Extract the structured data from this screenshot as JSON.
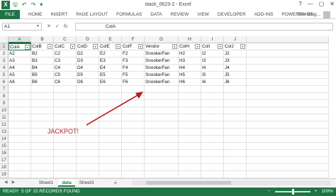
{
  "app": {
    "logo_letter": "X",
    "window_title": "stack_0623-2 - Excel",
    "help": "?",
    "minimize": "—",
    "restore": "▢",
    "close": "✕"
  },
  "qat": {
    "save": "🖫",
    "undo": "↶",
    "redo": "↷",
    "customize": "▾"
  },
  "ribbon": {
    "file": "FILE",
    "tabs": [
      "HOME",
      "INSERT",
      "PAGE LAYOUT",
      "FORMULAS",
      "DATA",
      "REVIEW",
      "VIEW",
      "DEVELOPER",
      "ADD-INS",
      "POWERPIVOT"
    ],
    "user": "Dan Wag..."
  },
  "formula_bar": {
    "name_box": "A1",
    "cancel": "✕",
    "enter": "✓",
    "fx": "fx",
    "content": "ColA"
  },
  "grid": {
    "columns": [
      "A",
      "B",
      "C",
      "D",
      "E",
      "F",
      "G",
      "H",
      "I",
      "J"
    ],
    "rows": [
      "1",
      "2",
      "3",
      "4",
      "5",
      "6",
      "7",
      "8",
      "9",
      "10",
      "11",
      "12",
      "13",
      "14",
      "15",
      "16",
      "17",
      "18",
      "19"
    ],
    "headers": [
      "ColA",
      "ColB",
      "ColC",
      "ColD",
      "ColE",
      "ColF",
      "Vendor",
      "ColH",
      "ColI",
      "ColJ"
    ],
    "data": [
      [
        "A2",
        "B2",
        "C2",
        "D2",
        "E2",
        "F2",
        "SnookerFan",
        "H2",
        "I2",
        "J2"
      ],
      [
        "A3",
        "B3",
        "C3",
        "D3",
        "E3",
        "F3",
        "SnookerFan",
        "H3",
        "I3",
        "J3"
      ],
      [
        "A4",
        "B4",
        "C4",
        "D4",
        "E4",
        "F4",
        "SnookerFan",
        "H4",
        "I4",
        "J4"
      ],
      [
        "A5",
        "B5",
        "C5",
        "D5",
        "E5",
        "F5",
        "SnookerFan",
        "H5",
        "I5",
        "J5"
      ],
      [
        "A6",
        "B6",
        "C6",
        "D6",
        "E6",
        "F6",
        "SnookerFan",
        "H6",
        "I6",
        "J6"
      ]
    ],
    "filter_glyph": "▾",
    "filter_active_glyph": "⊻"
  },
  "annotation": {
    "text": "JACKPOT!",
    "color": "#b91d1d"
  },
  "sheets": {
    "nav_prev": "◀",
    "nav_next": "▶",
    "tabs": [
      "Sheet1",
      "data",
      "Sheet3"
    ],
    "active": "data",
    "add": "+"
  },
  "status": {
    "ready": "READY",
    "records": "5 OF 15 RECORDS FOUND",
    "zoom_out": "−",
    "zoom_in": "+",
    "zoom": "100%"
  },
  "colors": {
    "accent": "#217346"
  }
}
